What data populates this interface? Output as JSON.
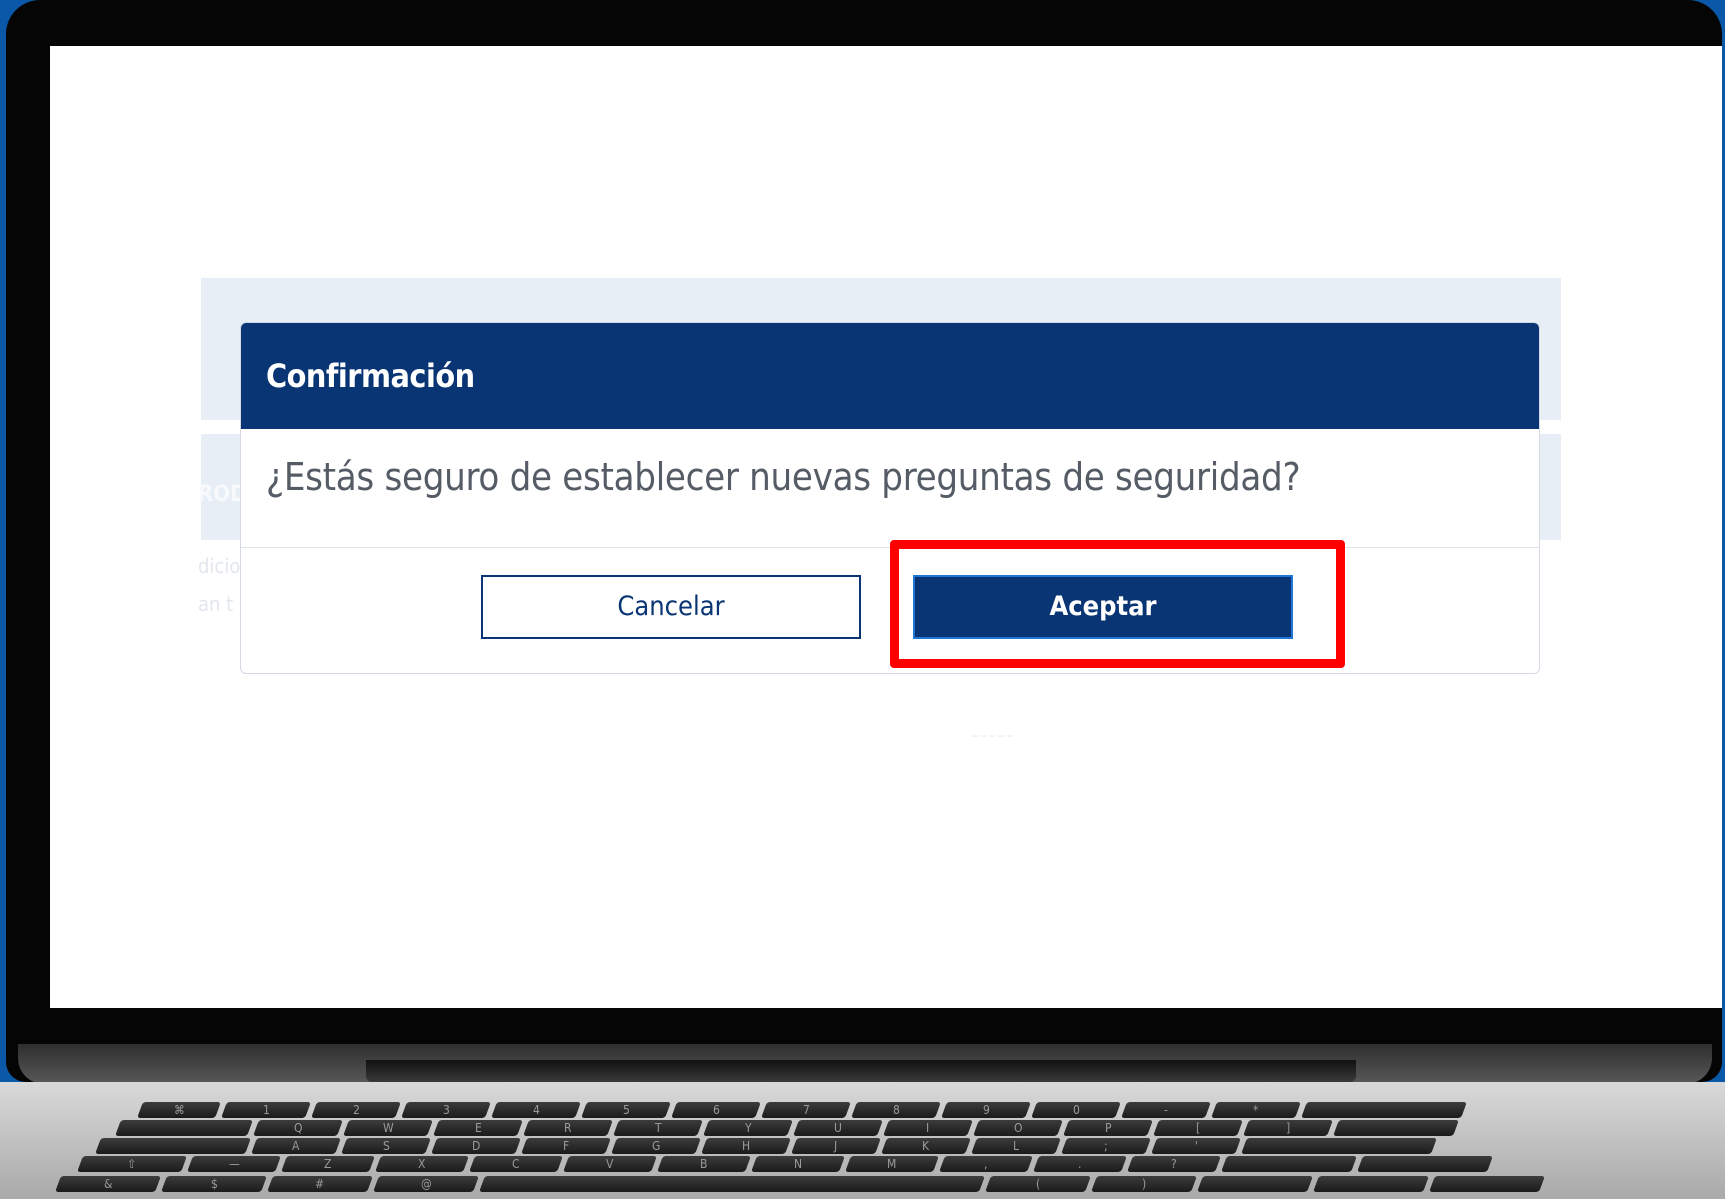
{
  "background_page": {
    "section_label_fragment": "ROD",
    "text_line_1_fragment": "dicio",
    "text_line_2_fragment": "an t"
  },
  "dialog": {
    "title": "Confirmación",
    "message": "¿Estás seguro de establecer nuevas preguntas de seguridad?",
    "cancel_label": "Cancelar",
    "accept_label": "Aceptar"
  },
  "highlight": {
    "target": "accept-button",
    "color": "#ff0000"
  },
  "colors": {
    "header_bg": "#0a3574",
    "primary_button": "#0a3574",
    "desktop_bg": "#0b57a8"
  },
  "keyboard": {
    "row1": [
      "⌘",
      "1",
      "2",
      "3",
      "4",
      "5",
      "6",
      "7",
      "8",
      "9",
      "0",
      "-",
      "*",
      ""
    ],
    "row2": [
      "",
      "Q",
      "W",
      "E",
      "R",
      "T",
      "Y",
      "U",
      "I",
      "O",
      "P",
      "[",
      "]",
      ""
    ],
    "row3": [
      "",
      "A",
      "S",
      "D",
      "F",
      "G",
      "H",
      "J",
      "K",
      "L",
      ";",
      "'",
      ""
    ],
    "row4": [
      "⇧",
      "—",
      "Z",
      "X",
      "C",
      "V",
      "B",
      "N",
      "M",
      ",",
      ".",
      "?",
      "",
      ""
    ],
    "row5": [
      "&",
      "$",
      "#",
      "@",
      "",
      "(",
      ")",
      "",
      "",
      ""
    ]
  }
}
